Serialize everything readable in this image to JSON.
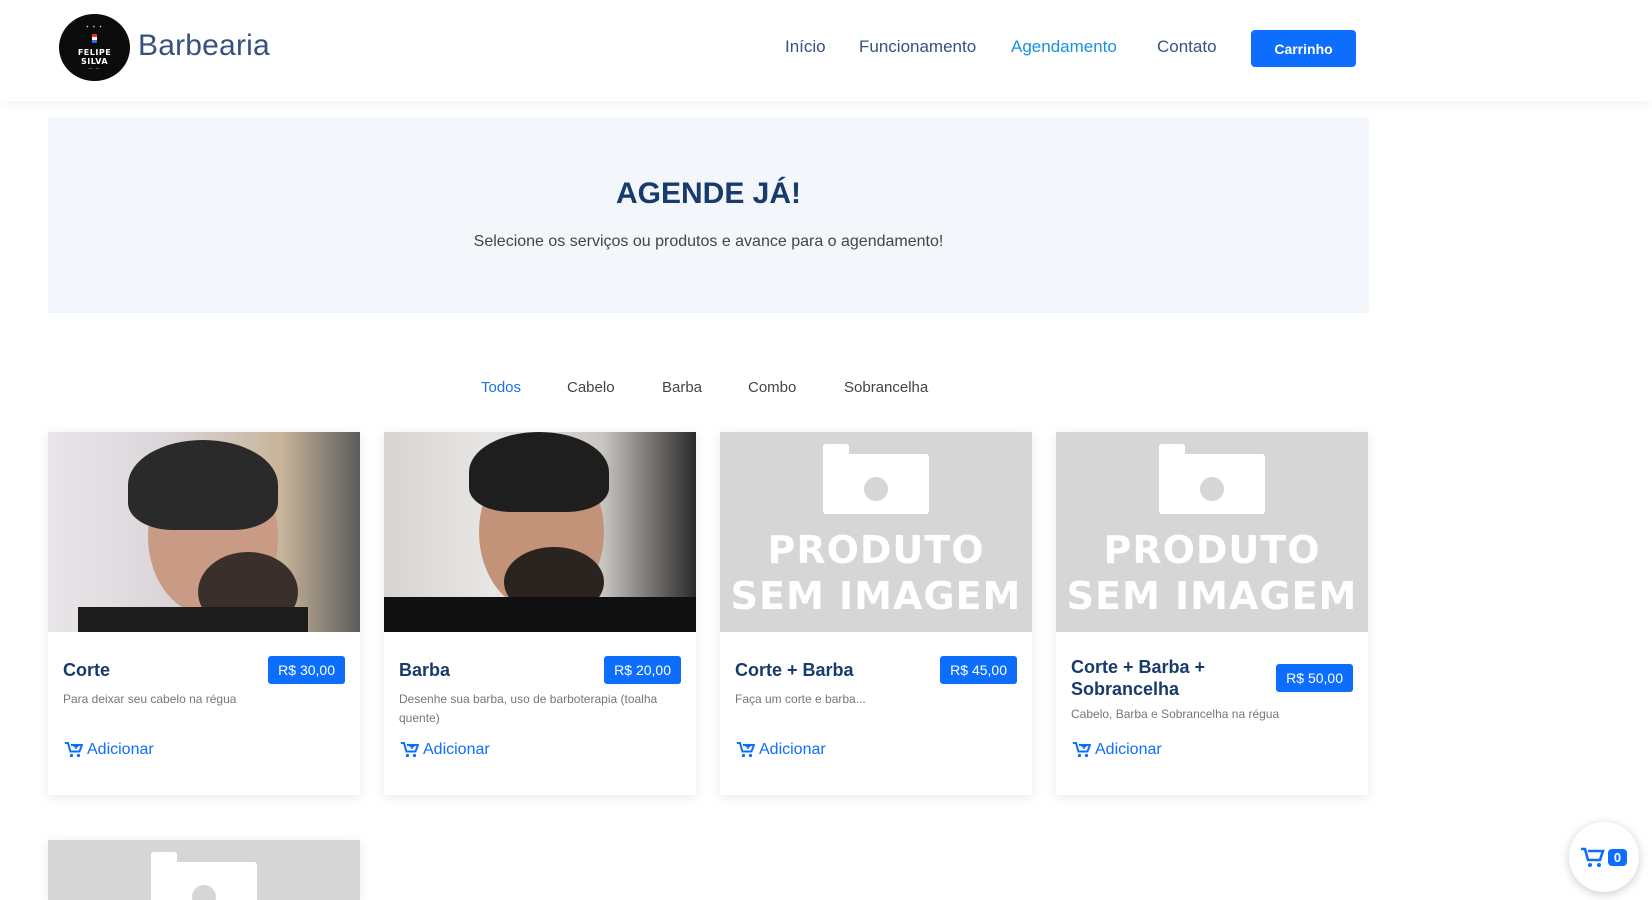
{
  "header": {
    "logo_text": [
      "FELIPE SILVA"
    ],
    "brand": "Barbearia",
    "nav": [
      "Início",
      "Funcionamento",
      "Agendamento",
      "Contato"
    ],
    "active_nav": "Agendamento",
    "cart_button": "Carrinho"
  },
  "hero": {
    "title": "AGENDE JÁ!",
    "subtitle": "Selecione os serviços ou produtos e avance para o agendamento!"
  },
  "filters": {
    "items": [
      "Todos",
      "Cabelo",
      "Barba",
      "Combo",
      "Sobrancelha"
    ],
    "active": "Todos"
  },
  "placeholder_text": [
    "PRODUTO",
    "SEM IMAGEM"
  ],
  "products": [
    {
      "title": "Corte",
      "price": "R$ 30,00",
      "desc": "Para deixar seu cabelo na régua",
      "add": "Adicionar",
      "image": "photo"
    },
    {
      "title": "Barba",
      "price": "R$ 20,00",
      "desc": "Desenhe sua barba, uso de barboterapia (toalha quente)",
      "add": "Adicionar",
      "image": "photo"
    },
    {
      "title": "Corte + Barba",
      "price": "R$ 45,00",
      "desc": "Faça um corte e barba...",
      "add": "Adicionar",
      "image": "placeholder"
    },
    {
      "title": "Corte + Barba + Sobrancelha",
      "price": "R$ 50,00",
      "desc": "Cabelo, Barba e Sobrancelha na régua",
      "add": "Adicionar",
      "image": "placeholder"
    }
  ],
  "floating_cart": {
    "count": "0",
    "icon": "cart-icon"
  },
  "colors": {
    "primary": "#0d6efd",
    "heading": "#173b6c",
    "nav": "#37517e",
    "nav_active": "#1a8fe0",
    "hero_bg": "#f3f7fb"
  }
}
